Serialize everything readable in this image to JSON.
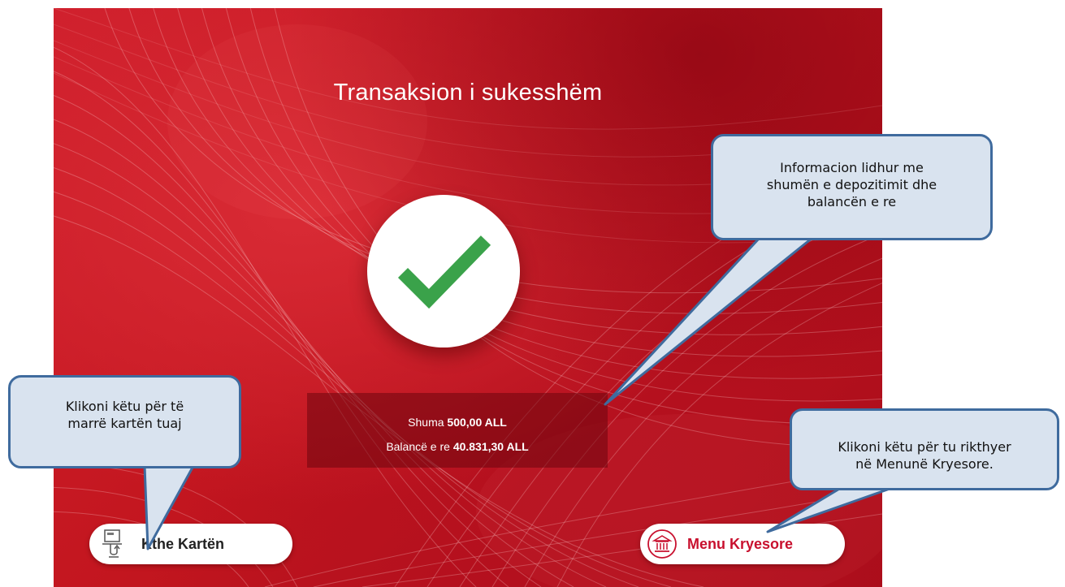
{
  "screen": {
    "title": "Transaksion i sukesshëm",
    "success_icon": "checkmark-icon",
    "colors": {
      "background": "#c8182a",
      "check": "#3aa24a",
      "accent": "#c8102e"
    }
  },
  "summary": {
    "amount_label": "Shuma",
    "amount_value": "500,00 ALL",
    "balance_label": "Balancë e re",
    "balance_value": "40.831,30 ALL"
  },
  "buttons": {
    "return_card": {
      "label": "Kthe Kartën",
      "icon": "card-return-icon"
    },
    "main_menu": {
      "label": "Menu Kryesore",
      "icon": "bank-building-icon"
    }
  },
  "callouts": {
    "info_line1": "Informacion lidhur me",
    "info_line2": "shumën e depozitimit dhe",
    "info_line3": "balancën e re",
    "card_line1": "Klikoni këtu për të",
    "card_line2": "marrë kartën tuaj",
    "menu_line1": "Klikoni këtu për tu rikthyer",
    "menu_line2": "në Menunë Kryesore."
  }
}
